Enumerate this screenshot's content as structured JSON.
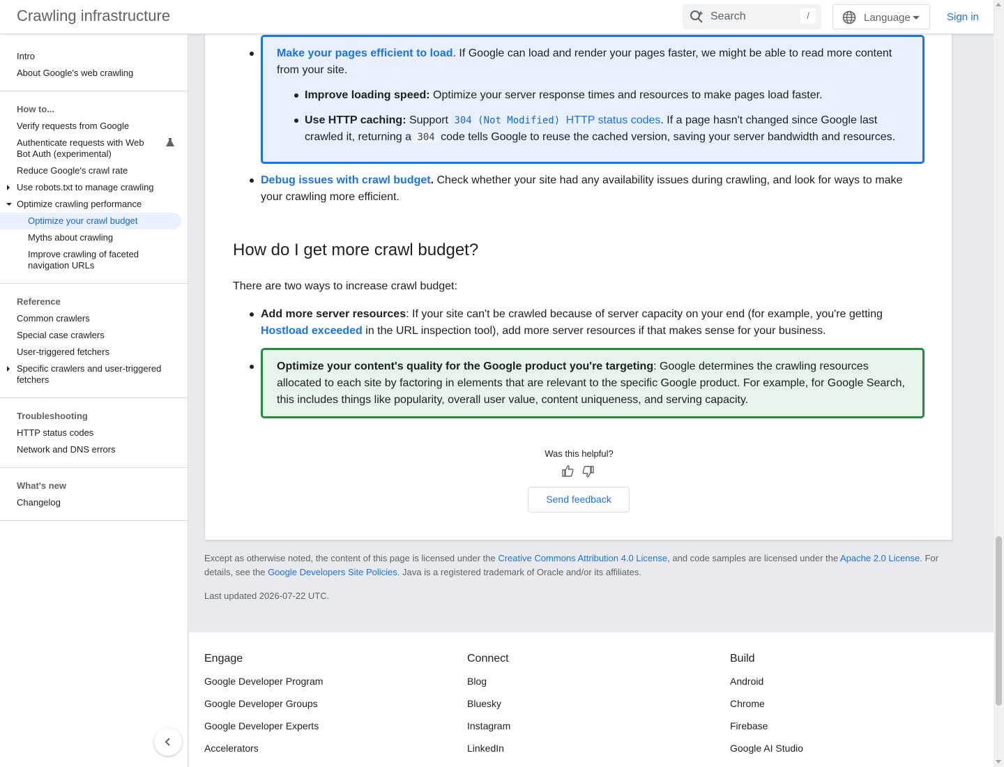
{
  "header": {
    "title": "Crawling infrastructure",
    "search_placeholder": "Search",
    "search_shortcut": "/",
    "language_label": "Language",
    "signin_label": "Sign in"
  },
  "sidebar": {
    "intro": "Intro",
    "about": "About Google's web crawling",
    "howto_heading": "How to...",
    "verify": "Verify requests from Google",
    "authenticate": "Authenticate requests with Web Bot Auth (experimental)",
    "reduce": "Reduce Google's crawl rate",
    "robots": "Use robots.txt to manage crawling",
    "optimize_perf": "Optimize crawling performance",
    "optimize_budget": "Optimize your crawl budget",
    "myths": "Myths about crawling",
    "faceted": "Improve crawling of faceted navigation URLs",
    "reference_heading": "Reference",
    "common": "Common crawlers",
    "special": "Special case crawlers",
    "user_triggered": "User-triggered fetchers",
    "specific": "Specific crawlers and user-triggered fetchers",
    "troubleshooting_heading": "Troubleshooting",
    "http_codes": "HTTP status codes",
    "network": "Network and DNS errors",
    "whatsnew_heading": "What's new",
    "changelog": "Changelog"
  },
  "content": {
    "efficient_link": "Make your pages efficient to load",
    "efficient_text": ". If Google can load and render your pages faster, we might be able to read more content from your site.",
    "speed_label": "Improve loading speed:",
    "speed_text": " Optimize your server response times and resources to make pages load faster.",
    "caching_label": "Use HTTP caching:",
    "caching_support": " Support ",
    "caching_code": "304 (Not Modified)",
    "caching_link": "HTTP status codes",
    "caching_text1": ". If a page hasn't changed since Google last crawled it, returning a ",
    "caching_code2": "304",
    "caching_text2": " code tells Google to reuse the cached version, saving your server bandwidth and resources.",
    "debug_link": "Debug issues with crawl budget",
    "debug_dot": ".",
    "debug_text": " Check whether your site had any availability issues during crawling, and look for ways to make your crawling more efficient.",
    "h2": "How do I get more crawl budget?",
    "intro": "There are two ways to increase crawl budget:",
    "add_label": "Add more server resources",
    "add_text1": ": If your site can't be crawled because of server capacity on your end (for example, you're getting ",
    "add_link": "Hostload exceeded",
    "add_text2": " in the URL inspection tool), add more server resources if that makes sense for your business.",
    "quality_label": "Optimize your content's quality for the Google product you're targeting",
    "quality_text": ": Google determines the crawling resources allocated to each site by factoring in elements that are relevant to the specific Google product. For example, for Google Search, this includes things like popularity, overall user value, content uniqueness, and serving capacity.",
    "helpful": "Was this helpful?",
    "feedback": "Send feedback"
  },
  "license": {
    "t1": "Except as otherwise noted, the content of this page is licensed under the ",
    "l1": "Creative Commons Attribution 4.0 License",
    "t2": ", and code samples are licensed under the ",
    "l2": "Apache 2.0 License",
    "t3": ". For details, see the ",
    "l3": "Google Developers Site Policies",
    "t4": ". Java is a registered trademark of Oracle and/or its affiliates.",
    "updated": "Last updated 2026-07-22 UTC."
  },
  "footer": {
    "engage": {
      "title": "Engage",
      "items": [
        "Google Developer Program",
        "Google Developer Groups",
        "Google Developer Experts",
        "Accelerators"
      ]
    },
    "connect": {
      "title": "Connect",
      "items": [
        "Blog",
        "Bluesky",
        "Instagram",
        "LinkedIn"
      ]
    },
    "build": {
      "title": "Build",
      "items": [
        "Android",
        "Chrome",
        "Firebase",
        "Google AI Studio"
      ]
    }
  },
  "colors": {
    "link": "#1a73e8",
    "highlight_blue": "#e8f0fe",
    "highlight_green": "#e6f4ea",
    "green_border": "#1e8e3e"
  }
}
